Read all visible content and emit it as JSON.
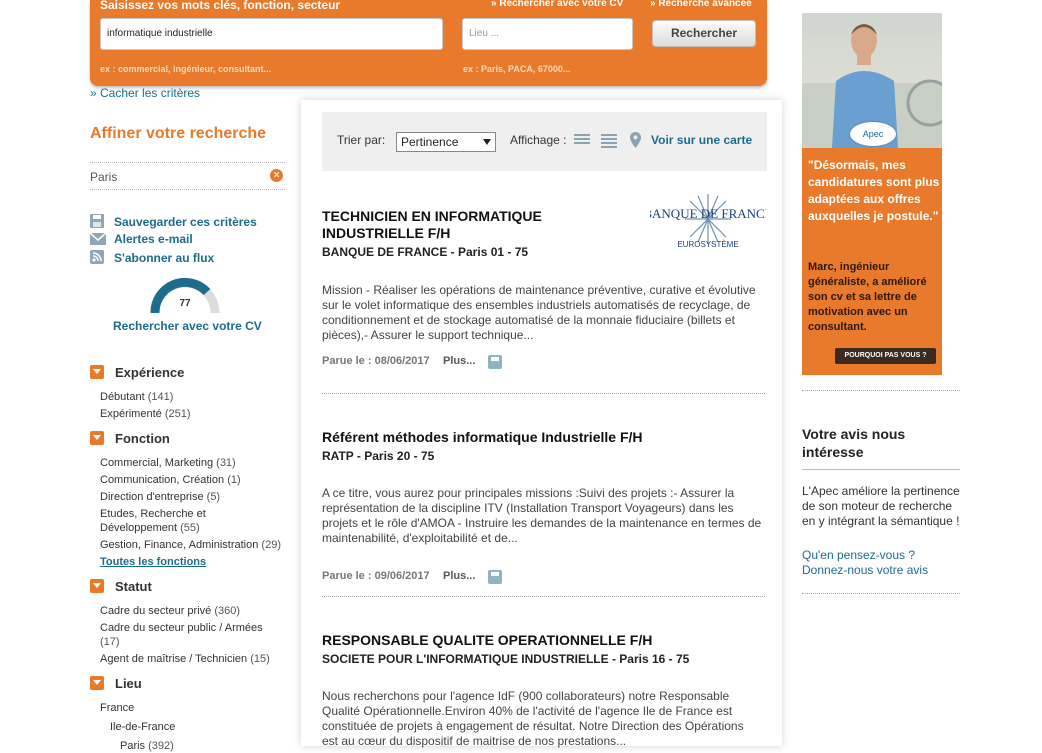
{
  "search": {
    "keywords_label": "Saisissez vos mots clés, fonction, secteur",
    "cv_search_link": "» Rechercher avec votre CV",
    "advanced_link": "» Recherche avancée",
    "keywords_value": "informatique industrielle",
    "keywords_hint": "ex : commercial, ingénieur, consultant...",
    "location_placeholder": "Lieu ...",
    "location_hint": "ex : Paris, PACA, 67000...",
    "search_button": "Rechercher",
    "hide_criteria": "» Cacher les critères"
  },
  "sidebar": {
    "title": "Affiner votre recherche",
    "active_filter": "Paris",
    "remove_icon": "×",
    "tools": [
      {
        "label": "Sauvegarder ces critères",
        "icon": "floppy-icon"
      },
      {
        "label": "Alertes e-mail",
        "icon": "envelope-icon"
      },
      {
        "label": "S'abonner au flux",
        "icon": "rss-icon"
      }
    ],
    "gauge_value": "77",
    "gauge_label": "Rechercher avec votre CV",
    "sections": [
      {
        "title": "Expérience",
        "options": [
          {
            "label": "Débutant",
            "count": "(141)"
          },
          {
            "label": "Expérimenté",
            "count": "(251)"
          }
        ]
      },
      {
        "title": "Fonction",
        "options": [
          {
            "label": "Commercial, Marketing",
            "count": "(31)"
          },
          {
            "label": "Communication, Création",
            "count": "(1)"
          },
          {
            "label": "Direction d'entreprise",
            "count": "(5)"
          },
          {
            "label": "Etudes, Recherche et Développement",
            "count": "(55)"
          },
          {
            "label": "Gestion, Finance, Administration",
            "count": "(29)"
          }
        ],
        "more": "Toutes les fonctions"
      },
      {
        "title": "Statut",
        "options": [
          {
            "label": "Cadre du secteur privé",
            "count": "(360)"
          },
          {
            "label": "Cadre du secteur public / Armées",
            "count": "(17)"
          },
          {
            "label": "Agent de maîtrise / Technicien",
            "count": "(15)"
          }
        ]
      },
      {
        "title": "Lieu",
        "options": [
          {
            "label": "France",
            "count": ""
          },
          {
            "label": "Ile-de-France",
            "count": ""
          },
          {
            "label": "Paris",
            "count": "(392)"
          }
        ]
      }
    ]
  },
  "toolbar": {
    "sort_label": "Trier par:",
    "sort_value": "Pertinence",
    "display_label": "Affichage :",
    "map_link": "Voir sur une carte"
  },
  "jobs": [
    {
      "title": "TECHNICIEN EN INFORMATIQUE INDUSTRIELLE F/H",
      "company": "BANQUE DE FRANCE",
      "location": " - Paris 01 - 75",
      "description": "Mission - Réaliser les opérations de maintenance préventive, curative et évolutive sur le volet informatique des ensembles industriels automatisés de recyclage, de conditionnement et de stockage automatisé de la monnaie fiduciaire (billets et pièces),- Assurer le support technique...",
      "date_label": "Parue le : 08/06/2017",
      "more": "Plus..."
    },
    {
      "title": "Référent méthodes informatique Industrielle F/H",
      "company": "RATP",
      "location": " - Paris 20 - 75",
      "description": "A ce titre, vous aurez pour principales missions :Suivi des projets :- Assurer la représentation de la discipline ITV (Installation Transport Voyageurs) dans les projets et le rôle d'AMOA - Instruire les demandes de la maintenance en termes de maintenabilité, d'exploitabilité et de...",
      "date_label": "Parue le : 09/06/2017",
      "more": "Plus..."
    },
    {
      "title": "RESPONSABLE QUALITE OPERATIONNELLE F/H",
      "company": "SOCIETE POUR L'INFORMATIQUE INDUSTRIELLE",
      "location": " - Paris 16 - 75",
      "description": "Nous recherchons pour l'agence IdF (900 collaborateurs) notre Responsable Qualité Opérationnelle.Environ 40% de l'activité de l'agence Ile de France est constituée de projets à engagement de résultat. Notre Direction des Opérations est au cœur du dispositif de maitrise de nos prestations...",
      "date_label": "",
      "more": ""
    }
  ],
  "logo": {
    "line1": "BANQUE DE FRANCE",
    "line2": "EUROSYSTÈME"
  },
  "ad": {
    "badge": "Apec",
    "quote": "\"Désormais, mes candidatures sont plus adaptées aux offres auxquelles je postule.\"",
    "signature": "Marc, ingénieur généraliste, a amélioré son cv et sa lettre de motivation avec un consultant.",
    "button": "POURQUOI PAS VOUS ?"
  },
  "feedback": {
    "title": "Votre avis nous intéresse",
    "text": "L'Apec améliore la pertinence de son moteur de recherche en y intégrant la sémantique !",
    "link1": "Qu'en pensez-vous ?",
    "link2": "Donnez-nous votre avis"
  },
  "colors": {
    "accent": "#e97a2b",
    "link": "#1e6c8c",
    "gauge": "#1e6c8c"
  }
}
